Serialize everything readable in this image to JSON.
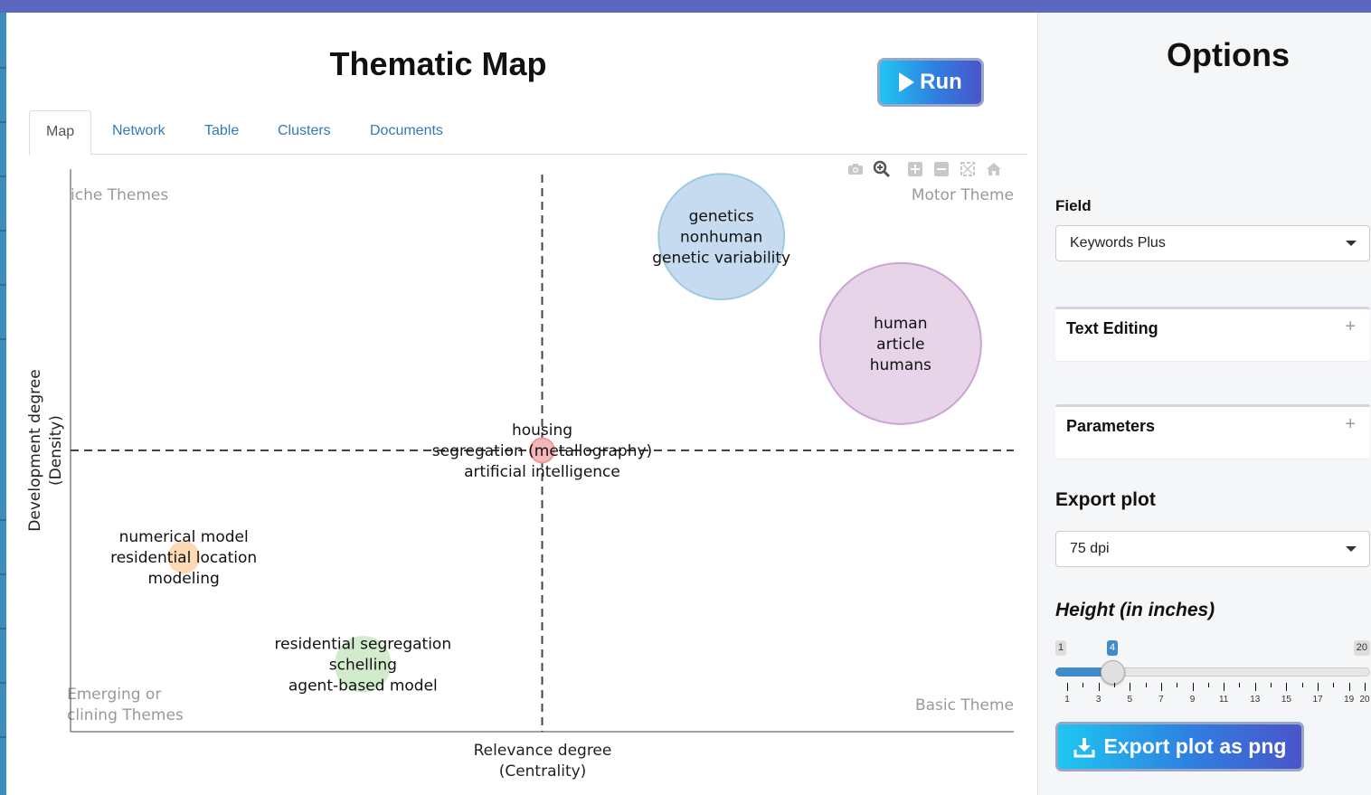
{
  "main": {
    "title": "Thematic Map",
    "run_label": "Run",
    "tabs": [
      {
        "label": "Map",
        "active": true
      },
      {
        "label": "Network",
        "active": false
      },
      {
        "label": "Table",
        "active": false
      },
      {
        "label": "Clusters",
        "active": false
      },
      {
        "label": "Documents",
        "active": false
      }
    ],
    "modebar": [
      "camera-icon",
      "zoom-icon",
      "zoom-in-icon",
      "zoom-out-icon",
      "autoscale-icon",
      "home-icon"
    ]
  },
  "chart_data": {
    "type": "scatter",
    "xlabel": [
      "Relevance degree",
      "(Centrality)"
    ],
    "ylabel": [
      "Development degree",
      "(Density)"
    ],
    "quadrant_labels": {
      "top_left": [
        "iche Themes"
      ],
      "top_right": [
        "Motor Theme"
      ],
      "bottom_left": [
        "Emerging or",
        "clining Themes"
      ],
      "bottom_right": [
        "Basic Theme"
      ]
    },
    "bubbles": [
      {
        "labels": [
          "genetics",
          "nonhuman",
          "genetic variability"
        ],
        "x": 0.69,
        "y": 0.88,
        "size": 0.78,
        "color": "#c6dbef",
        "stroke": "#9ecae1"
      },
      {
        "labels": [
          "human",
          "article",
          "humans"
        ],
        "x": 0.88,
        "y": 0.69,
        "size": 1.0,
        "color": "#e7d4e8",
        "stroke": "#c9a5d2"
      },
      {
        "labels": [
          "housing",
          "segregation (metallography)",
          "artificial intelligence"
        ],
        "x": 0.5,
        "y": 0.5,
        "size": 0.15,
        "color": "#f4b6b8",
        "stroke": "#ef9a9c"
      },
      {
        "labels": [
          "numerical model",
          "residential location",
          "modeling"
        ],
        "x": 0.12,
        "y": 0.31,
        "size": 0.19,
        "color": "#fdd9b5",
        "stroke": "#fdd9b5"
      },
      {
        "labels": [
          "residential segregation",
          "schelling",
          "agent-based model"
        ],
        "x": 0.31,
        "y": 0.12,
        "size": 0.34,
        "color": "#d3ebcd",
        "stroke": "#d3ebcd"
      }
    ],
    "ref_lines": {
      "x": 0.5,
      "y": 0.5
    }
  },
  "sidebar": {
    "title": "Options",
    "field_label": "Field",
    "field_value": "Keywords Plus",
    "panels": [
      "Text Editing",
      "Parameters"
    ],
    "export_title": "Export plot",
    "dpi_value": "75 dpi",
    "height_label": "Height (in inches)",
    "slider": {
      "min": 1,
      "max": 20,
      "value": 4,
      "tick_labels": [
        "1",
        "3",
        "5",
        "7",
        "9",
        "11",
        "13",
        "15",
        "17",
        "19",
        "20"
      ]
    },
    "export_button": "Export plot as png"
  }
}
